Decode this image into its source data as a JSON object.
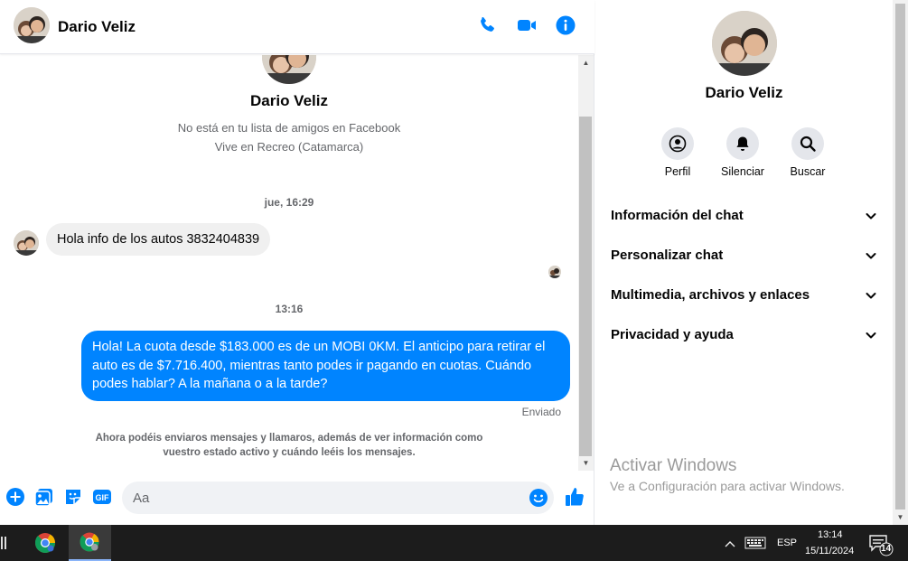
{
  "contact": {
    "name": "Dario Veliz",
    "friend_status": "No está en tu lista de amigos en Facebook",
    "location": "Vive en Recreo (Catamarca)"
  },
  "header": {
    "icons": [
      "phone-icon",
      "video-icon",
      "info-icon"
    ]
  },
  "conversation": {
    "timestamp_1": "jue, 16:29",
    "incoming_message": "Hola info  de los autos 3832404839",
    "timestamp_2": "13:16",
    "outgoing_message": "Hola! La cuota desde $183.000 es de un MOBI 0KM. El anticipo para retirar el auto es de $7.716.400, mientras tanto podes ir pagando en cuotas. Cuándo podes hablar? A la mañana o a la tarde?",
    "sent_status": "Enviado",
    "notice_line_1": "Ahora podéis enviaros mensajes y llamaros, además de ver información como",
    "notice_line_2": "vuestro estado activo y cuándo leéis los mensajes."
  },
  "composer": {
    "placeholder": "Aa",
    "value": "",
    "gif_label": "GIF"
  },
  "info_panel": {
    "actions": [
      {
        "label": "Perfil",
        "icon": "profile-icon"
      },
      {
        "label": "Silenciar",
        "icon": "bell-icon"
      },
      {
        "label": "Buscar",
        "icon": "search-icon"
      }
    ],
    "sections": [
      "Información del chat",
      "Personalizar chat",
      "Multimedia, archivos y enlaces",
      "Privacidad y ayuda"
    ]
  },
  "watermark": {
    "title": "Activar Windows",
    "subtitle": "Ve a Configuración para activar Windows."
  },
  "taskbar": {
    "language": "ESP",
    "time": "13:14",
    "date": "15/11/2024",
    "notification_count": "14"
  },
  "colors": {
    "accent": "#0084ff",
    "bubble_in": "#f0f0f0",
    "taskbar": "#1c1c1c"
  }
}
